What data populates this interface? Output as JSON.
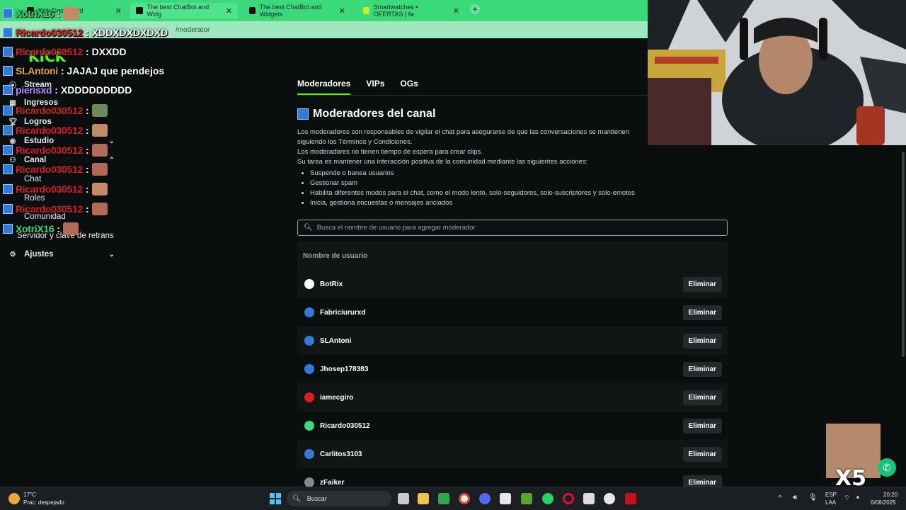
{
  "browser": {
    "tabs": [
      {
        "title": "Kick Dashboard"
      },
      {
        "title": "The best ChatBot and Widg"
      },
      {
        "title": "The best ChatBot and Widgets"
      },
      {
        "title": "Smartwatches • OFERTAS | fa"
      }
    ],
    "url": "/moderator"
  },
  "sidebar": {
    "logo": "KICK",
    "items": [
      {
        "label": "Stream",
        "icon": "broadcast-icon"
      },
      {
        "label": "Ingresos",
        "icon": "money-icon"
      },
      {
        "label": "Logros",
        "icon": "trophy-icon"
      },
      {
        "label": "Estudio",
        "icon": "studio-icon"
      },
      {
        "label": "Canal",
        "icon": "channel-icon"
      },
      {
        "label": "Chat",
        "icon": ""
      },
      {
        "label": "Roles",
        "icon": ""
      },
      {
        "label": "Comunidad",
        "icon": ""
      },
      {
        "label": "Servidor y clave de retrans",
        "icon": ""
      },
      {
        "label": "Ajustes",
        "icon": "gear-icon"
      }
    ]
  },
  "chat": [
    {
      "user": "XotriX16",
      "color": "#3cd97a",
      "msg": ""
    },
    {
      "user": "Ricardo030512",
      "color": "#d81f26",
      "msg": "XDDXDXDXDXD"
    },
    {
      "user": "Ricardo030512",
      "color": "#d81f26",
      "msg": "DXXDD"
    },
    {
      "user": "SLAntoni",
      "color": "#e6a23c",
      "msg": "JAJAJ que pendejos"
    },
    {
      "user": "pierisxd",
      "color": "#b38bff",
      "msg": "XDDDDDDDDD"
    },
    {
      "user": "Ricardo030512",
      "color": "#d81f26",
      "msg": ""
    },
    {
      "user": "Ricardo030512",
      "color": "#d81f26",
      "msg": ""
    },
    {
      "user": "Ricardo030512",
      "color": "#d81f26",
      "msg": ""
    },
    {
      "user": "Ricardo030512",
      "color": "#d81f26",
      "msg": ""
    },
    {
      "user": "Ricardo030512",
      "color": "#d81f26",
      "msg": ""
    },
    {
      "user": "Ricardo030512",
      "color": "#d81f26",
      "msg": ""
    },
    {
      "user": "XotriX16",
      "color": "#3cd97a",
      "msg": ""
    }
  ],
  "main": {
    "tabs": [
      "Moderadores",
      "VIPs",
      "OGs"
    ],
    "title": "Moderadores del canal",
    "desc1": "Los moderadores son responsables de vigilar el chat para asegurarse de que las conversaciones se mantienen",
    "desc2": "siguiendo los Términos y Condiciones.",
    "desc3": "Los moderadores no tienen tiempo de espera para crear clips.",
    "desc4": "Su tarea es mantener una interacción positiva de la comunidad mediante las siguientes acciones:",
    "bullets": [
      "Suspende o banea usuarios",
      "Gestionar spam",
      "Habilita diferentes modos para el chat, como el modo lento, solo-seguidores, solo-suscriptores y solo-emotes",
      "Inicia, gestiona encuestas o mensajes anclados"
    ],
    "search_placeholder": "Busca el nombre de usuario para agregar moderador",
    "column_header": "Nombre de usuario",
    "remove_label": "Eliminar",
    "moderators": [
      {
        "name": "BotRix",
        "avatar": "#ffffff"
      },
      {
        "name": "Fabriciururxd",
        "avatar": "#2f7bd6"
      },
      {
        "name": "SLAntoni",
        "avatar": "#2f7bd6"
      },
      {
        "name": "Jhosep178383",
        "avatar": "#2f7bd6"
      },
      {
        "name": "iamecgiro",
        "avatar": "#d81f26"
      },
      {
        "name": "Ricardo030512",
        "avatar": "#3cd97a"
      },
      {
        "name": "Carlitos3103",
        "avatar": "#2f7bd6"
      },
      {
        "name": "zFaiker",
        "avatar": "#888888"
      }
    ]
  },
  "taskbar": {
    "weather_temp": "17°C",
    "weather_desc": "Prac. despejado",
    "search": "Buscar",
    "lang1": "ESP",
    "lang2": "LAA",
    "time": "20:20",
    "date": "6/08/2025"
  },
  "overlay": {
    "multiplier": "X5"
  }
}
